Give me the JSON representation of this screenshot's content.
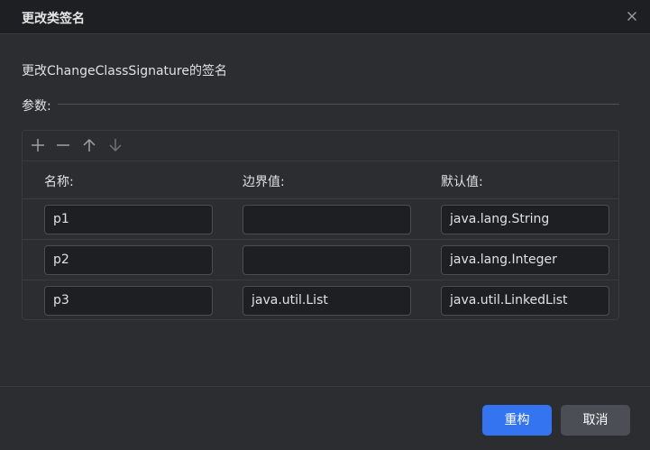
{
  "dialog": {
    "title": "更改类签名",
    "description": "更改ChangeClassSignature的签名"
  },
  "params": {
    "label": "参数:",
    "toolbar": [
      "add-icon",
      "remove-icon",
      "move-up-icon",
      "move-down-icon"
    ],
    "columns": [
      "名称:",
      "边界值:",
      "默认值:"
    ],
    "rows": [
      {
        "name": "p1",
        "bound": "",
        "default": "java.lang.String"
      },
      {
        "name": "p2",
        "bound": "",
        "default": "java.lang.Integer"
      },
      {
        "name": "p3",
        "bound": "java.util.List",
        "default": "java.util.LinkedList"
      }
    ]
  },
  "footer": {
    "refactor_label": "重构",
    "cancel_label": "取消"
  },
  "colors": {
    "accent": "#3574f0",
    "background": "#2b2d30"
  }
}
